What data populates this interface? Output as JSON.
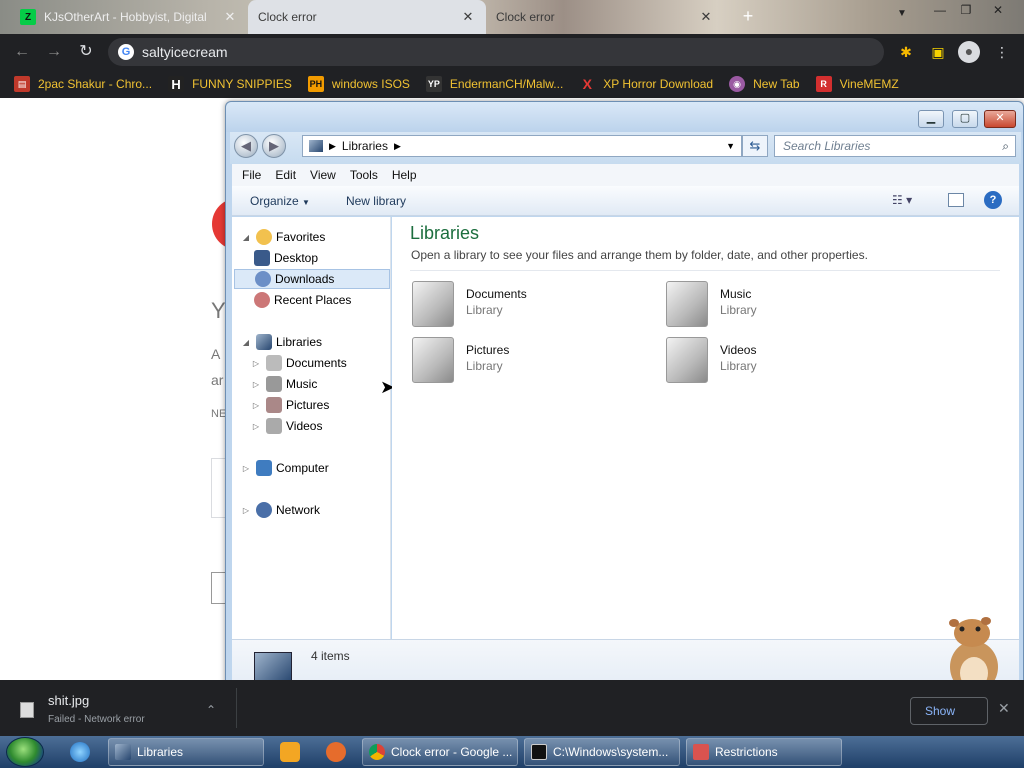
{
  "browser": {
    "tabs": [
      {
        "label": "KJsOtherArt - Hobbyist, Digital",
        "icon": "deviantart-icon",
        "active": false
      },
      {
        "label": "Clock error",
        "icon": "",
        "active": true
      },
      {
        "label": "Clock error",
        "icon": "",
        "active": false
      }
    ],
    "url": "saltyicecream",
    "bookmarks": [
      {
        "label": "2pac Shakur - Chro...",
        "icon": "bookmark-icon"
      },
      {
        "label": "FUNNY SNIPPIES",
        "icon": "h-icon"
      },
      {
        "label": "windows ISOS",
        "icon": "ph-icon"
      },
      {
        "label": "EndermanCH/Malw...",
        "icon": "yp-icon"
      },
      {
        "label": "XP Horror Download",
        "icon": "x-icon"
      },
      {
        "label": "New Tab",
        "icon": "globe-icon"
      },
      {
        "label": "VineMEMZ",
        "icon": "r-icon"
      }
    ]
  },
  "explorer": {
    "address_crumb": "Libraries",
    "search_placeholder": "Search Libraries",
    "menu": [
      "File",
      "Edit",
      "View",
      "Tools",
      "Help"
    ],
    "commands": {
      "organize": "Organize",
      "new_library": "New library"
    },
    "nav": {
      "favorites": "Favorites",
      "desktop": "Desktop",
      "downloads": "Downloads",
      "recent": "Recent Places",
      "libraries": "Libraries",
      "documents": "Documents",
      "music": "Music",
      "pictures": "Pictures",
      "videos": "Videos",
      "computer": "Computer",
      "network": "Network"
    },
    "title": "Libraries",
    "subtitle": "Open a library to see your files and arrange them by folder, date, and other properties.",
    "libraries": [
      {
        "name": "Documents",
        "type": "Library"
      },
      {
        "name": "Music",
        "type": "Library"
      },
      {
        "name": "Pictures",
        "type": "Library"
      },
      {
        "name": "Videos",
        "type": "Library"
      }
    ],
    "item_count": "4 items"
  },
  "download": {
    "filename": "shit.jpg",
    "status": "Failed - Network error",
    "show_all": "Show"
  },
  "page_fragments": {
    "a": "Y",
    "b": "A",
    "c": "ar",
    "d": "NE"
  },
  "taskbar": {
    "tasks": [
      {
        "label": "Libraries"
      },
      {
        "label": "Clock error - Google ..."
      },
      {
        "label": "C:\\Windows\\system..."
      },
      {
        "label": "Restrictions"
      }
    ]
  },
  "colors": {
    "accent": "#1c6e3e",
    "chrome_dark": "#202124",
    "bookmark_text": "#f1c232",
    "taskbar": "#1f3f68"
  }
}
